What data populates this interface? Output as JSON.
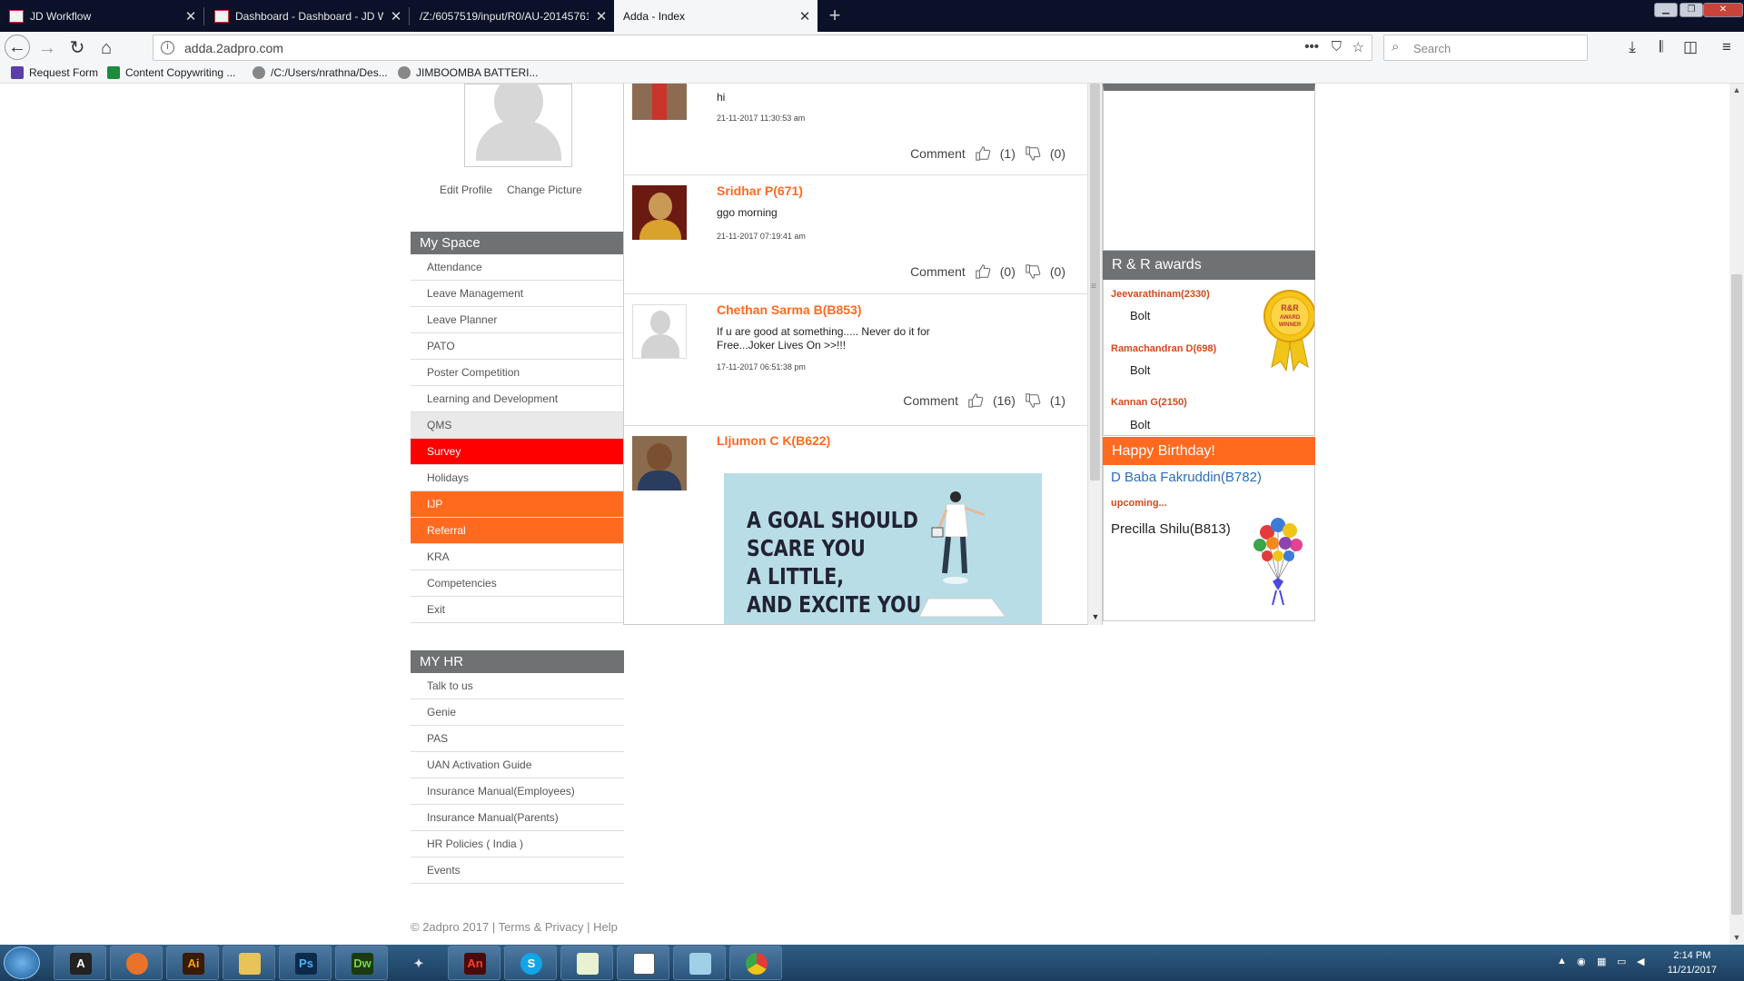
{
  "browser": {
    "tabs": [
      {
        "title": "JD Workflow",
        "active": false
      },
      {
        "title": "Dashboard - Dashboard - JD Workflow",
        "active": false
      },
      {
        "title": "/Z:/6057519/input/R0/AU-20145761",
        "active": false
      },
      {
        "title": "Adda - Index",
        "active": true
      }
    ],
    "url": "adda.2adpro.com",
    "search_placeholder": "Search",
    "bookmarks": [
      "Request Form",
      "Content Copywriting ...",
      "/C:/Users/nrathna/Des...",
      "JIMBOOMBA BATTERI..."
    ]
  },
  "profile": {
    "edit_label": "Edit Profile",
    "change_label": "Change Picture"
  },
  "my_space": {
    "title": "My Space",
    "items": [
      "Attendance",
      "Leave Management",
      "Leave Planner",
      "PATO",
      "Poster Competition",
      "Learning and Development",
      "QMS",
      "Survey",
      "Holidays",
      "IJP",
      "Referral",
      "KRA",
      "Competencies",
      "Exit"
    ]
  },
  "my_hr": {
    "title": "MY HR",
    "items": [
      "Talk to us",
      "Genie",
      "PAS",
      "UAN Activation Guide",
      "Insurance Manual(Employees)",
      "Insurance Manual(Parents)",
      "HR Policies ( India )",
      "Events"
    ]
  },
  "footer": {
    "copyright": "© 2adpro 2017",
    "terms": "Terms & Privacy",
    "help": "Help"
  },
  "feed": {
    "comment_label": "Comment",
    "posts": [
      {
        "name": "",
        "text": "hi",
        "date": "21-11-2017 11:30:53 am",
        "likes": "(1)",
        "dislikes": "(0)"
      },
      {
        "name": "Sridhar P(671)",
        "text": "ggo morning",
        "date": "21-11-2017 07:19:41 am",
        "likes": "(0)",
        "dislikes": "(0)"
      },
      {
        "name": "Chethan Sarma B(B853)",
        "text": "If u are good at something..... Never do it for Free...Joker Lives On >>!!!",
        "date": "17-11-2017 06:51:38 pm",
        "likes": "(16)",
        "dislikes": "(1)"
      },
      {
        "name": "LIjumon C K(B622)",
        "text": "",
        "date": "",
        "likes": "",
        "dislikes": ""
      }
    ],
    "image_text": [
      "A GOAL SHOULD",
      "SCARE YOU",
      "A LITTLE,",
      "AND EXCITE YOU"
    ]
  },
  "rr_awards": {
    "title": "R & R awards",
    "entries": [
      {
        "name": "Jeevarathinam(2330)",
        "award": "Bolt"
      },
      {
        "name": "Ramachandran D(698)",
        "award": "Bolt"
      },
      {
        "name": "Kannan G(2150)",
        "award": "Bolt"
      }
    ],
    "medal_text": [
      "R&R",
      "AWARD",
      "WINNER"
    ]
  },
  "birthday": {
    "title": "Happy Birthday!",
    "today": "D Baba Fakruddin(B782)",
    "upcoming_label": "upcoming...",
    "upcoming": "Precilla Shilu(B813)"
  },
  "taskbar": {
    "apps": [
      "A",
      "Firefox",
      "Ai",
      "Explorer",
      "Ps",
      "Dw",
      "Xd",
      "An",
      "Skype",
      "Notepad",
      "Editor",
      "Scanner",
      "Chrome"
    ],
    "time": "2:14 PM",
    "date": "11/21/2017"
  }
}
